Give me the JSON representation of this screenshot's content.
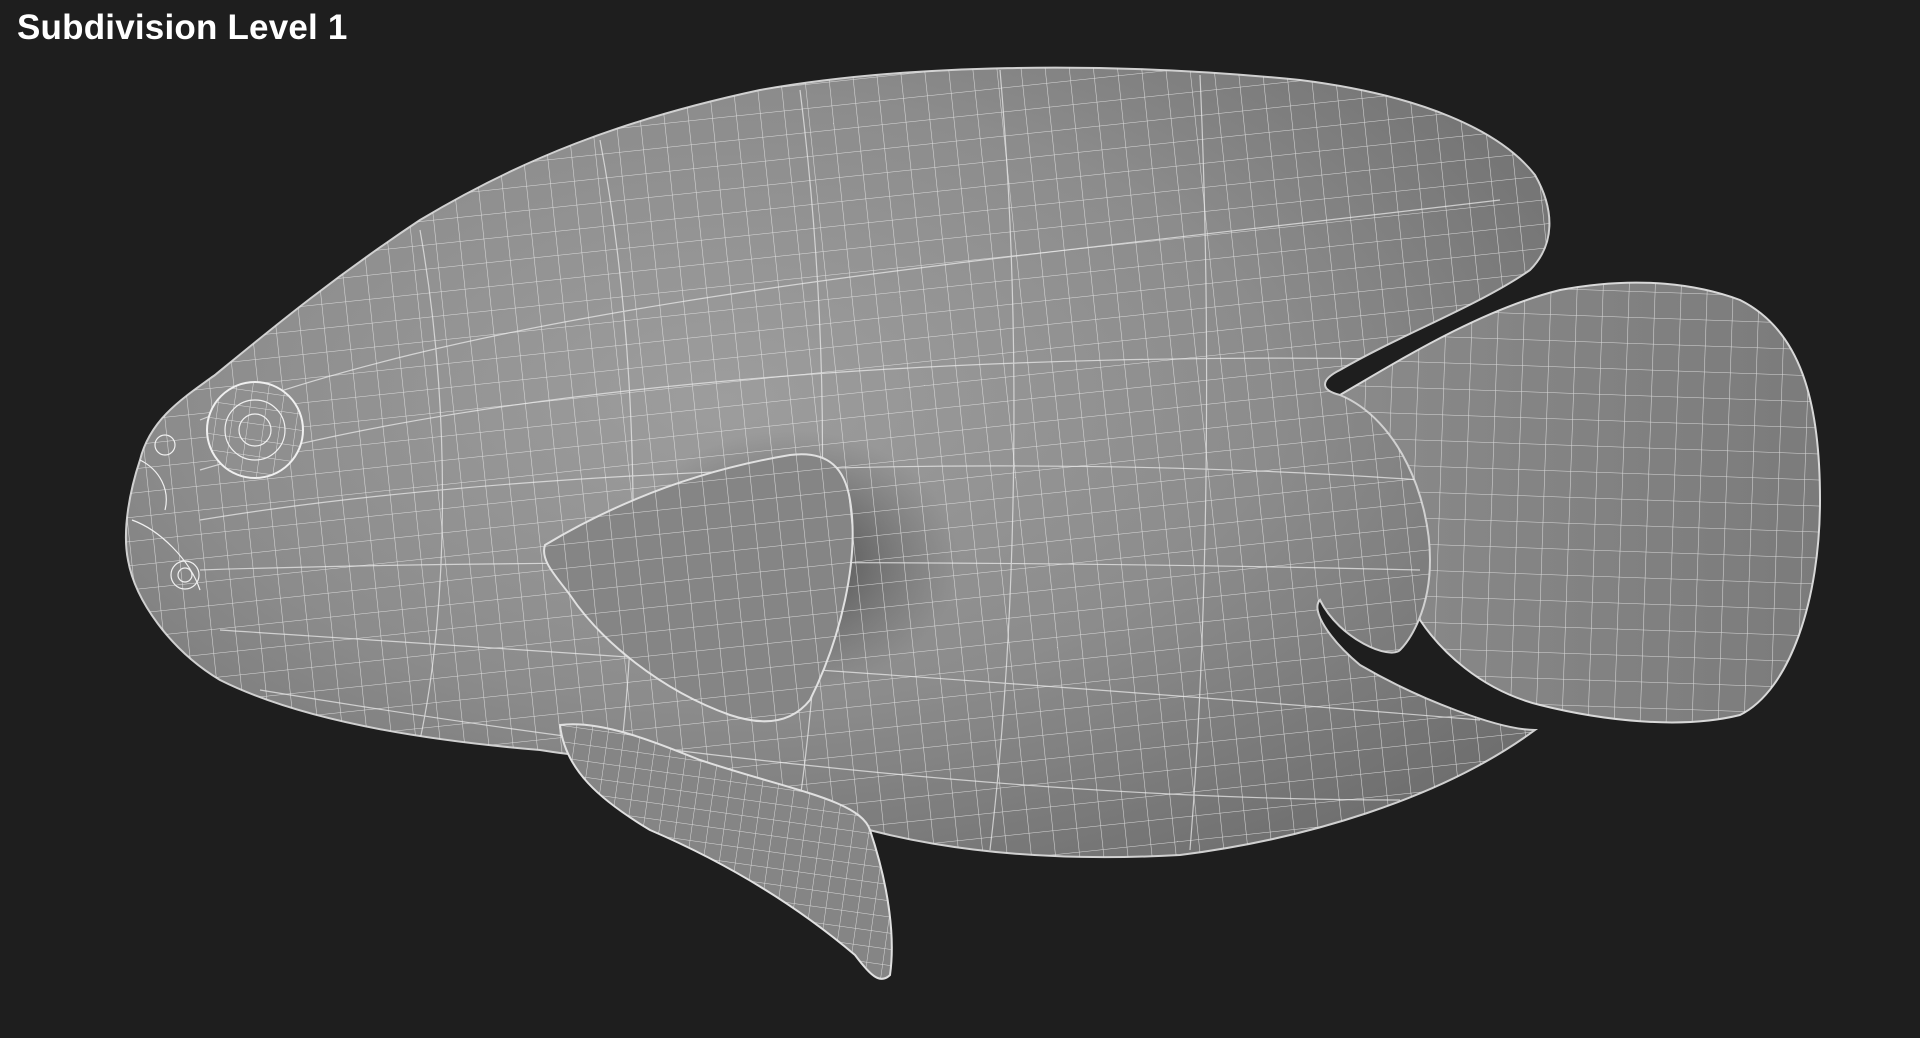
{
  "viewport": {
    "label": "Subdivision Level 1",
    "background_color": "#1e1e1e"
  },
  "model": {
    "subject": "fish",
    "display_mode": "wireframe-on-shaded",
    "surface_color": "#8a8a8a",
    "wire_color": "#e6e6e6"
  }
}
